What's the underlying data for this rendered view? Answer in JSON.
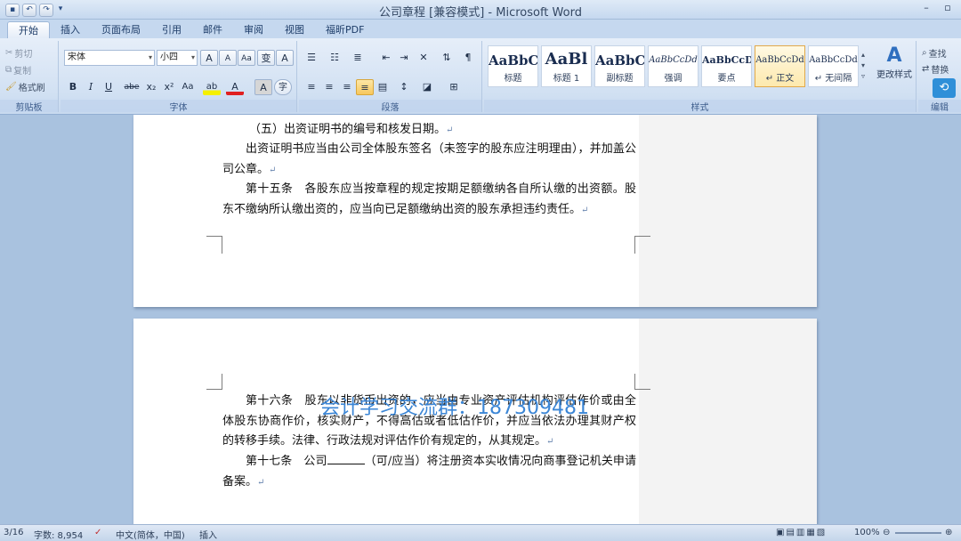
{
  "window": {
    "title": "公司章程 [兼容模式] - Microsoft Word",
    "quick_access": [
      "save-icon",
      "undo-icon",
      "redo-icon"
    ],
    "controls": {
      "minimize": "–",
      "restore": "▫"
    }
  },
  "tabs": [
    {
      "label": "开始",
      "active": true
    },
    {
      "label": "插入"
    },
    {
      "label": "页面布局"
    },
    {
      "label": "引用"
    },
    {
      "label": "邮件"
    },
    {
      "label": "审阅"
    },
    {
      "label": "视图"
    },
    {
      "label": "福昕PDF"
    }
  ],
  "ribbon": {
    "clipboard": {
      "cut": "剪切",
      "copy": "复制",
      "format_painter": "格式刷",
      "label": "剪贴板"
    },
    "font": {
      "font_name": "宋体",
      "font_size": "小四",
      "grow": "A",
      "shrink": "A",
      "clear": "Aa",
      "phonetic": "变",
      "border": "A",
      "bold": "B",
      "italic": "I",
      "underline": "U",
      "strike": "abe",
      "subscript": "x₂",
      "superscript": "x²",
      "case": "Aa",
      "highlight": "ab",
      "color": "A",
      "shade": "A",
      "enclose": "字",
      "label": "字体"
    },
    "paragraph": {
      "label": "段落"
    },
    "styles": {
      "items": [
        {
          "sample": "AaBbC",
          "name": "标题"
        },
        {
          "sample": "AaBl",
          "name": "标题 1"
        },
        {
          "sample": "AaBbC",
          "name": "副标题"
        },
        {
          "sample": "AaBbCcDd",
          "name": "强调"
        },
        {
          "sample": "AaBbCcD",
          "name": "要点"
        },
        {
          "sample": "AaBbCcDd",
          "name": "↵ 正文",
          "selected": true
        },
        {
          "sample": "AaBbCcDd",
          "name": "↵ 无间隔"
        }
      ],
      "change_styles": "更改样式",
      "label": "样式"
    },
    "editing": {
      "find": "查找",
      "replace": "替换",
      "label": "编辑"
    }
  },
  "document": {
    "page1": [
      "（五）出资证明书的编号和核发日期。",
      "出资证明书应当由公司全体股东签名（未签字的股东应注明理由），并加盖公司公章。",
      "第十五条　各股东应当按章程的规定按期足额缴纳各自所认缴的出资额。股东不缴纳所认缴出资的，应当向已足额缴纳出资的股东承担违约责任。"
    ],
    "page2": [
      "第十六条　股东以非货币出资的，应当由专业资产评估机构评估作价或由全体股东协商作价，核实财产，不得高估或者低估作价，并应当依法办理其财产权的转移手续。法律、行政法规对评估作价有规定的，从其规定。",
      {
        "before": "第十七条　公司",
        "after": "（可/应当）将注册资本实收情况向商事登记机关申请备案。"
      }
    ],
    "para_mark": "↵"
  },
  "watermark": "会计学习交流群：187309481",
  "status": {
    "page": "3/16",
    "words": "字数: 8,954",
    "language": "中文(简体，中国)",
    "mode": "插入",
    "zoom": "100%"
  }
}
